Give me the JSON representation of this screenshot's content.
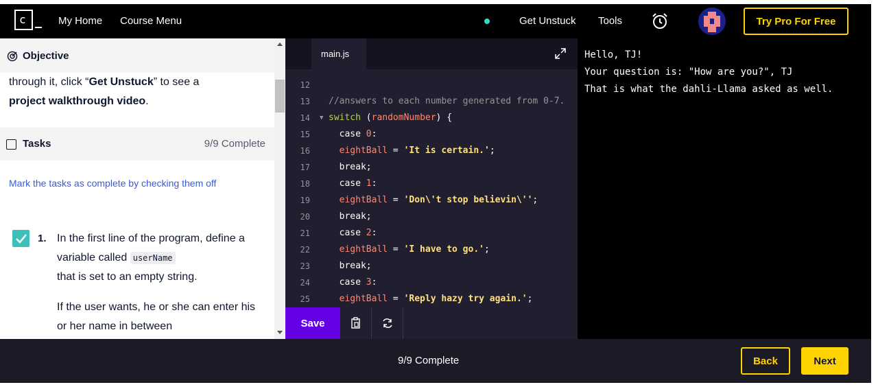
{
  "nav": {
    "logo_char": "c",
    "my_home": "My Home",
    "course_menu": "Course Menu",
    "get_unstuck": "Get Unstuck",
    "tools": "Tools",
    "try_pro": "Try Pro For Free"
  },
  "objective": {
    "header": "Objective",
    "line1_pre": "through it, click “",
    "line1_bold": "Get Unstuck",
    "line1_post": "” to see a",
    "line2_bold": "project walkthrough video",
    "line2_post": "."
  },
  "tasks": {
    "header": "Tasks",
    "count": "9/9 Complete",
    "hint": "Mark the tasks as complete by checking them off",
    "task1": {
      "number": "1.",
      "text_a": "In the first line of the program, define a variable called ",
      "code": "userName",
      "text_b": "that is set to an empty string.",
      "para2": "If the user wants, he or she can enter his or her name in between"
    }
  },
  "editor": {
    "tab": "main.js",
    "save": "Save",
    "lines": [
      {
        "n": "12",
        "parts": []
      },
      {
        "n": "13",
        "parts": [
          {
            "c": "cm",
            "t": "//answers to each number generated from 0-7."
          }
        ]
      },
      {
        "n": "14",
        "fold": true,
        "parts": [
          {
            "c": "kw",
            "t": "switch"
          },
          {
            "c": "plain",
            "t": " ("
          },
          {
            "c": "vr",
            "t": "randomNumber"
          },
          {
            "c": "plain",
            "t": ") {"
          }
        ]
      },
      {
        "n": "15",
        "parts": [
          {
            "c": "plain",
            "t": "  case "
          },
          {
            "c": "nm",
            "t": "0"
          },
          {
            "c": "plain",
            "t": ":"
          }
        ]
      },
      {
        "n": "16",
        "parts": [
          {
            "c": "vr",
            "t": "  eightBall"
          },
          {
            "c": "plain",
            "t": " = "
          },
          {
            "c": "st",
            "t": "'It is certain.'"
          },
          {
            "c": "plain",
            "t": ";"
          }
        ]
      },
      {
        "n": "17",
        "parts": [
          {
            "c": "plain",
            "t": "  break;"
          }
        ]
      },
      {
        "n": "18",
        "parts": [
          {
            "c": "plain",
            "t": "  case "
          },
          {
            "c": "nm",
            "t": "1"
          },
          {
            "c": "plain",
            "t": ":"
          }
        ]
      },
      {
        "n": "19",
        "parts": [
          {
            "c": "vr",
            "t": "  eightBall"
          },
          {
            "c": "plain",
            "t": " = "
          },
          {
            "c": "st",
            "t": "'Don\\'t stop believin\\''"
          },
          {
            "c": "plain",
            "t": ";"
          }
        ]
      },
      {
        "n": "20",
        "parts": [
          {
            "c": "plain",
            "t": "  break;"
          }
        ]
      },
      {
        "n": "21",
        "parts": [
          {
            "c": "plain",
            "t": "  case "
          },
          {
            "c": "nm",
            "t": "2"
          },
          {
            "c": "plain",
            "t": ":"
          }
        ]
      },
      {
        "n": "22",
        "parts": [
          {
            "c": "vr",
            "t": "  eightBall"
          },
          {
            "c": "plain",
            "t": " = "
          },
          {
            "c": "st",
            "t": "'I have to go.'"
          },
          {
            "c": "plain",
            "t": ";"
          }
        ]
      },
      {
        "n": "23",
        "parts": [
          {
            "c": "plain",
            "t": "  break;"
          }
        ]
      },
      {
        "n": "24",
        "parts": [
          {
            "c": "plain",
            "t": "  case "
          },
          {
            "c": "nm",
            "t": "3"
          },
          {
            "c": "plain",
            "t": ":"
          }
        ]
      },
      {
        "n": "25",
        "parts": [
          {
            "c": "vr",
            "t": "  eightBall"
          },
          {
            "c": "plain",
            "t": " = "
          },
          {
            "c": "st",
            "t": "'Reply hazy try again.'"
          },
          {
            "c": "plain",
            "t": ";"
          }
        ]
      }
    ]
  },
  "output": {
    "lines": [
      "Hello, TJ!",
      "Your question is: \"How are you?\", TJ",
      "That is what the dahli-Llama asked as well."
    ]
  },
  "footer": {
    "progress": "9/9 Complete",
    "back": "Back",
    "next": "Next"
  },
  "colors": {
    "accent_yellow": "#ffd300",
    "save_purple": "#6400e4",
    "check_teal": "#3cc0b8",
    "dot_teal": "#3ad6c4"
  },
  "icons": {
    "objective": "target-icon",
    "tasks": "checkbox-icon",
    "alarm": "alarm-clock-icon",
    "expand": "expand-icon",
    "copy": "clipboard-icon",
    "reset": "refresh-icon"
  }
}
